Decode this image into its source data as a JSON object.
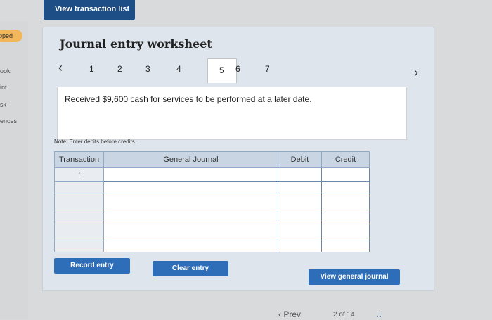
{
  "top": {
    "view_transaction_list": "View transaction list"
  },
  "sidebar": {
    "status": "pped",
    "links": [
      "ook",
      "int",
      "sk",
      "ences"
    ]
  },
  "worksheet": {
    "title": "Journal entry worksheet",
    "tabs": [
      "1",
      "2",
      "3",
      "4",
      "5",
      "6",
      "7"
    ],
    "active_tab": "5",
    "description": "Received $9,600 cash for services to be performed at a later date.",
    "note": "Note: Enter debits before credits."
  },
  "table": {
    "headers": {
      "transaction": "Transaction",
      "general_journal": "General Journal",
      "debit": "Debit",
      "credit": "Credit"
    },
    "rows": [
      {
        "transaction": "f",
        "gj": "",
        "debit": "",
        "credit": ""
      },
      {
        "transaction": "",
        "gj": "",
        "debit": "",
        "credit": ""
      },
      {
        "transaction": "",
        "gj": "",
        "debit": "",
        "credit": ""
      },
      {
        "transaction": "",
        "gj": "",
        "debit": "",
        "credit": ""
      },
      {
        "transaction": "",
        "gj": "",
        "debit": "",
        "credit": ""
      },
      {
        "transaction": "",
        "gj": "",
        "debit": "",
        "credit": ""
      }
    ]
  },
  "buttons": {
    "record": "Record entry",
    "clear": "Clear entry",
    "view_general_journal": "View general journal"
  },
  "footer": {
    "prev": "Prev",
    "page": "2 of 14"
  },
  "icons": {
    "prev_tab": "chevron-left-icon",
    "next_tab": "chevron-right-icon",
    "prev_page": "chevron-left-icon",
    "grid": "grid-icon"
  },
  "colors": {
    "primary": "#2e6eb8",
    "top_bar": "#1d4f86",
    "status_pill": "#f2b65b"
  }
}
